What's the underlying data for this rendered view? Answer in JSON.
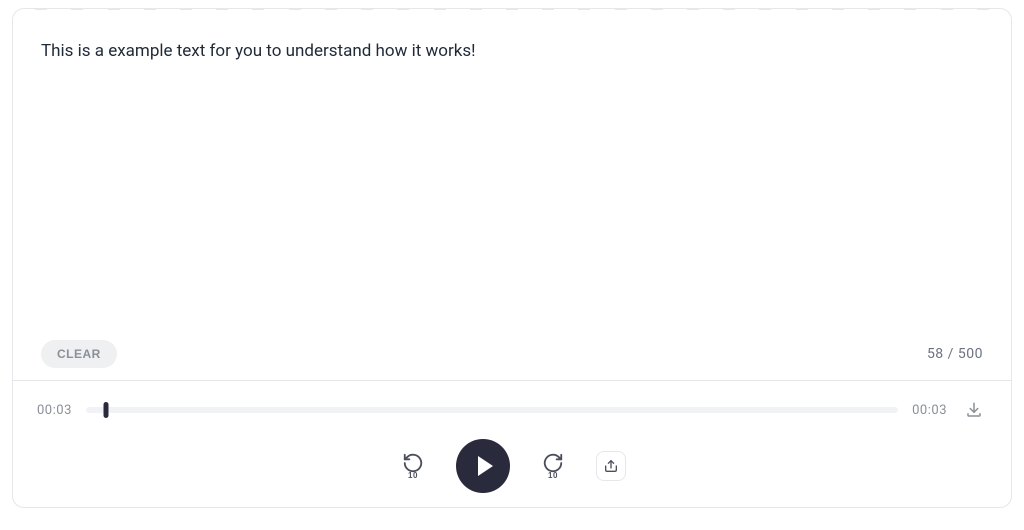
{
  "text": "This is a example text for you to understand how it works!",
  "clear_label": "CLEAR",
  "char_count": "58 / 500",
  "player": {
    "current_time": "00:03",
    "total_time": "00:03",
    "skip_label": "10"
  }
}
